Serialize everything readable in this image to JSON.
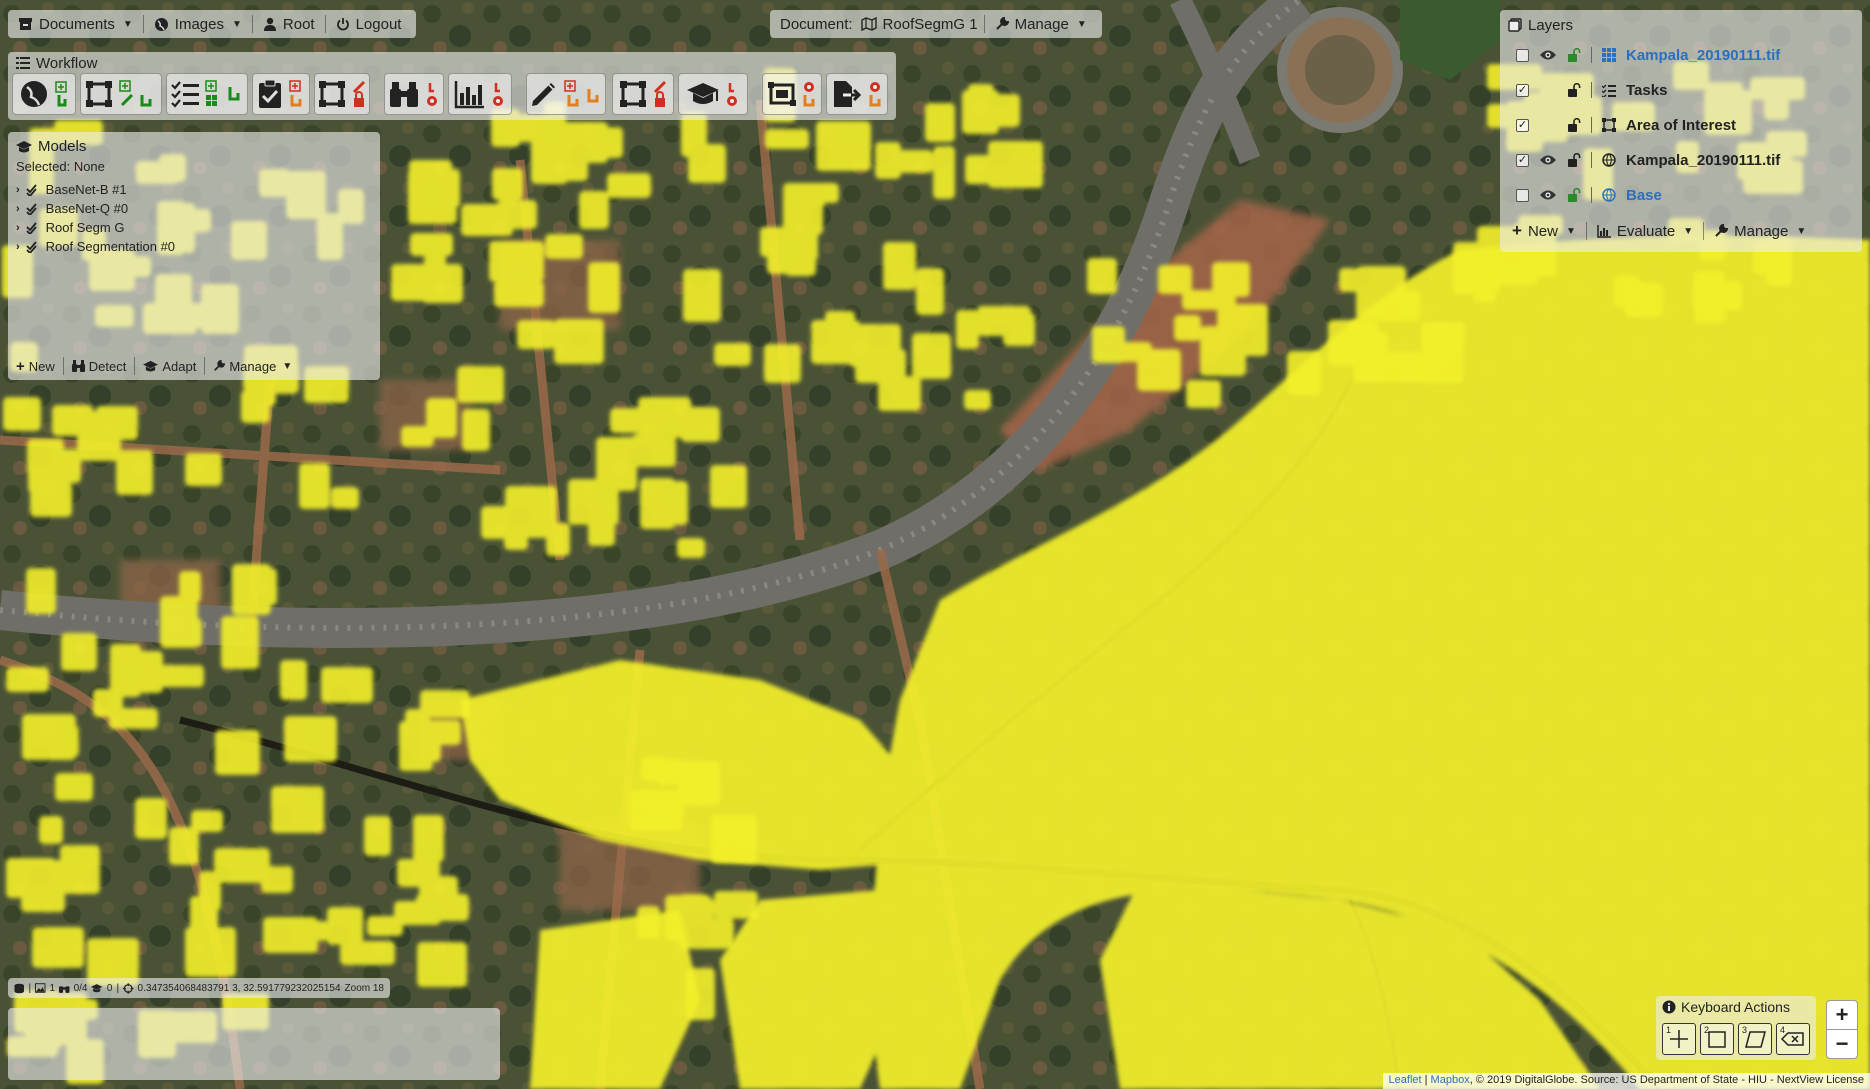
{
  "colors": {
    "imagery_dark": "#4f4c3c",
    "vegetation": "#3e4a30",
    "soil": "#9a6a4a",
    "road": "#6b6a64",
    "segmentation": "#f3f02a",
    "panel": "#eeeeee",
    "accent_link": "#2a6fc0"
  },
  "topbar": {
    "documents_label": "Documents",
    "images_label": "Images",
    "root_label": "Root",
    "logout_label": "Logout",
    "document_prefix": "Document:",
    "document_name": "RoofSegmG 1",
    "manage_label": "Manage"
  },
  "workflow": {
    "title": "Workflow",
    "buttons": [
      "georeference",
      "add-annotation",
      "tasks",
      "validate",
      "area-of-interest",
      "detect",
      "evaluate",
      "inspect",
      "polygon-edit",
      "train",
      "crop-export",
      "export"
    ]
  },
  "models": {
    "title": "Models",
    "selected_label": "Selected: None",
    "items": [
      "BaseNet-B #1",
      "BaseNet-Q #0",
      "Roof Segm G",
      "Roof Segmentation #0"
    ],
    "footer": {
      "new": "New",
      "detect": "Detect",
      "adapt": "Adapt",
      "manage": "Manage"
    }
  },
  "layers": {
    "title": "Layers",
    "items": [
      {
        "name": "Kampala_20190111.tif",
        "checked": false,
        "visible": true,
        "icon": "grid-icon",
        "color": "#2a6fc0"
      },
      {
        "name": "Tasks",
        "checked": true,
        "visible": false,
        "icon": "list-icon",
        "color": "#222222"
      },
      {
        "name": "Area of Interest",
        "checked": true,
        "visible": false,
        "icon": "aoi-icon",
        "color": "#222222"
      },
      {
        "name": "Kampala_20190111.tif",
        "checked": true,
        "visible": true,
        "icon": "globe-icon",
        "color": "#222222"
      },
      {
        "name": "Base",
        "checked": false,
        "visible": true,
        "icon": "globe-icon",
        "color": "#2a6fc0"
      }
    ],
    "footer": {
      "new": "New",
      "evaluate": "Evaluate",
      "manage": "Manage"
    }
  },
  "status": {
    "images": "1",
    "detections": "0/4",
    "models": "0",
    "coordinates": "0.347354068483791 3, 32.591779232025154",
    "zoom": "Zoom 18"
  },
  "keyboard": {
    "title": "Keyboard Actions",
    "keys": [
      "1",
      "2",
      "3",
      "4"
    ]
  },
  "zoom": {
    "in": "+",
    "out": "−"
  },
  "attribution": {
    "leaflet": "Leaflet",
    "mapbox": "Mapbox",
    "text": ", © 2019 DigitalGlobe. Source: US Department of State - HIU - NextView License"
  }
}
